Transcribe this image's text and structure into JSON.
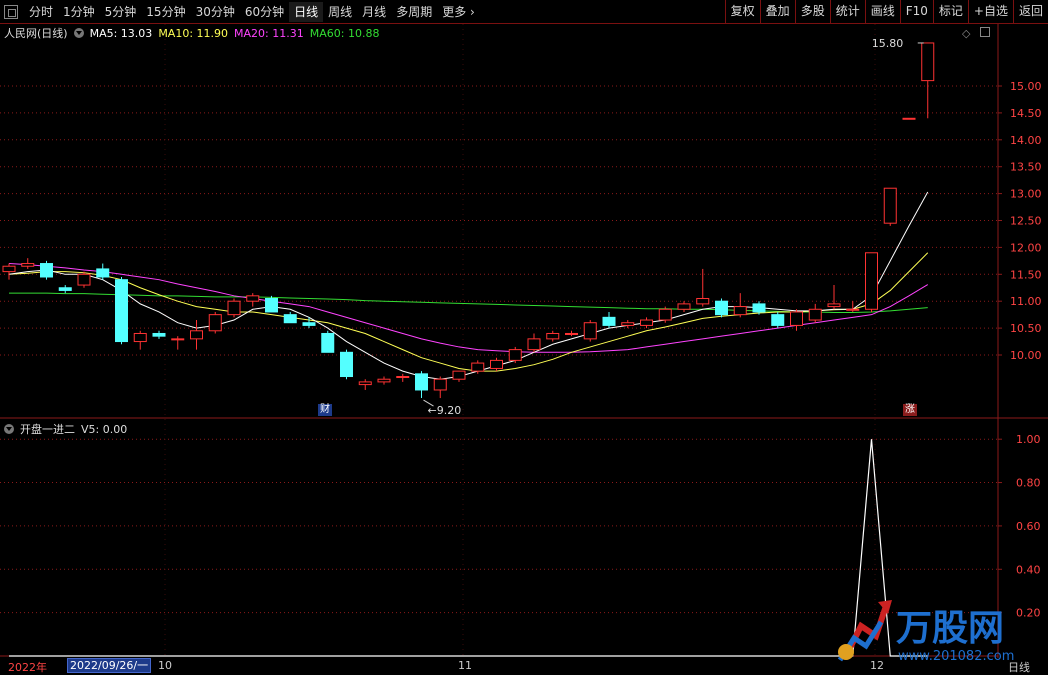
{
  "toolbar": {
    "periods": [
      "分时",
      "1分钟",
      "5分钟",
      "15分钟",
      "30分钟",
      "60分钟",
      "日线",
      "周线",
      "月线",
      "多周期",
      "更多"
    ],
    "active_period": "日线",
    "buttons": [
      "复权",
      "叠加",
      "多股",
      "统计",
      "画线",
      "F10",
      "标记",
      "+自选",
      "返回"
    ]
  },
  "title": {
    "stock": "人民网(日线)",
    "ma5": "MA5: 13.03",
    "ma10": "MA10: 11.90",
    "ma20": "MA20: 11.31",
    "ma60": "MA60: 10.88"
  },
  "indicator": {
    "name": "开盘一进二",
    "value": "V5: 0.00"
  },
  "annotations": {
    "high": "15.80",
    "low": "9.20",
    "cai": "财",
    "zhang": "涨"
  },
  "date_axis": {
    "year": "2022年",
    "date": "2022/09/26/一",
    "m10": "10",
    "m11": "11",
    "m12": "12",
    "period": "日线"
  },
  "watermark": {
    "brand": "万股网",
    "url": "www.201082.com"
  },
  "colors": {
    "up": "#ff3333",
    "down": "#54ffff",
    "ma5": "#ffffff",
    "ma10": "#ffff55",
    "ma20": "#ff44ff",
    "ma60": "#33dd33",
    "grid": "#8b1a1a"
  },
  "chart_data": [
    {
      "type": "candlestick",
      "ylim": [
        9.0,
        16.2
      ],
      "y_ticks": [
        "15.00",
        "14.50",
        "14.00",
        "13.50",
        "13.00",
        "12.50",
        "12.00",
        "11.50",
        "11.00",
        "10.50",
        "10.00"
      ],
      "x_months": [
        "10",
        "11",
        "12"
      ],
      "candles": [
        [
          11.55,
          11.7,
          11.4,
          11.65
        ],
        [
          11.65,
          11.8,
          11.6,
          11.7
        ],
        [
          11.7,
          11.75,
          11.4,
          11.45
        ],
        [
          11.25,
          11.3,
          11.15,
          11.2
        ],
        [
          11.3,
          11.55,
          11.25,
          11.5
        ],
        [
          11.6,
          11.7,
          11.4,
          11.45
        ],
        [
          11.4,
          11.45,
          10.2,
          10.25
        ],
        [
          10.25,
          10.45,
          10.1,
          10.4
        ],
        [
          10.4,
          10.45,
          10.3,
          10.35
        ],
        [
          10.3,
          10.35,
          10.1,
          10.3
        ],
        [
          10.3,
          10.65,
          10.1,
          10.45
        ],
        [
          10.45,
          10.8,
          10.4,
          10.75
        ],
        [
          10.75,
          11.05,
          10.7,
          11.0
        ],
        [
          11.0,
          11.15,
          10.9,
          11.1
        ],
        [
          11.05,
          11.1,
          10.8,
          10.8
        ],
        [
          10.75,
          10.8,
          10.6,
          10.6
        ],
        [
          10.6,
          10.7,
          10.5,
          10.55
        ],
        [
          10.4,
          10.45,
          10.05,
          10.05
        ],
        [
          10.05,
          10.1,
          9.55,
          9.6
        ],
        [
          9.45,
          9.55,
          9.35,
          9.5
        ],
        [
          9.5,
          9.6,
          9.45,
          9.55
        ],
        [
          9.6,
          9.65,
          9.5,
          9.6
        ],
        [
          9.65,
          9.7,
          9.2,
          9.35
        ],
        [
          9.35,
          9.6,
          9.2,
          9.55
        ],
        [
          9.55,
          9.7,
          9.5,
          9.7
        ],
        [
          9.7,
          9.9,
          9.65,
          9.85
        ],
        [
          9.75,
          9.95,
          9.7,
          9.9
        ],
        [
          9.9,
          10.15,
          9.85,
          10.1
        ],
        [
          10.1,
          10.4,
          10.05,
          10.3
        ],
        [
          10.3,
          10.45,
          10.25,
          10.4
        ],
        [
          10.4,
          10.45,
          10.35,
          10.4
        ],
        [
          10.3,
          10.65,
          10.25,
          10.6
        ],
        [
          10.7,
          10.8,
          10.5,
          10.55
        ],
        [
          10.55,
          10.65,
          10.5,
          10.6
        ],
        [
          10.55,
          10.7,
          10.5,
          10.65
        ],
        [
          10.65,
          10.9,
          10.6,
          10.85
        ],
        [
          10.85,
          11.0,
          10.8,
          10.95
        ],
        [
          10.95,
          11.6,
          10.9,
          11.05
        ],
        [
          11.0,
          11.05,
          10.7,
          10.75
        ],
        [
          10.75,
          11.15,
          10.7,
          10.9
        ],
        [
          10.95,
          11.0,
          10.75,
          10.8
        ],
        [
          10.75,
          10.8,
          10.5,
          10.55
        ],
        [
          10.55,
          10.85,
          10.45,
          10.8
        ],
        [
          10.65,
          10.95,
          10.6,
          10.85
        ],
        [
          10.9,
          11.3,
          10.85,
          10.95
        ],
        [
          10.85,
          11.0,
          10.8,
          10.85
        ],
        [
          10.85,
          10.95,
          10.8,
          11.9
        ],
        [
          12.45,
          13.1,
          12.4,
          13.1
        ],
        [
          14.4,
          14.4,
          14.4,
          14.4
        ],
        [
          15.1,
          15.8,
          14.4,
          15.8
        ]
      ],
      "ma5": [
        11.5,
        11.55,
        11.58,
        11.5,
        11.5,
        11.4,
        11.2,
        10.95,
        10.8,
        10.6,
        10.5,
        10.55,
        10.65,
        10.85,
        10.9,
        10.85,
        10.7,
        10.5,
        10.25,
        10.05,
        9.85,
        9.7,
        9.6,
        9.55,
        9.6,
        9.7,
        9.8,
        9.9,
        10.05,
        10.2,
        10.3,
        10.4,
        10.5,
        10.55,
        10.6,
        10.65,
        10.75,
        10.85,
        10.9,
        10.9,
        10.88,
        10.85,
        10.82,
        10.82,
        10.85,
        10.85,
        11.1,
        11.75,
        12.4,
        13.03
      ],
      "ma10": [
        11.5,
        11.52,
        11.55,
        11.55,
        11.53,
        11.48,
        11.4,
        11.25,
        11.12,
        11.0,
        10.9,
        10.85,
        10.8,
        10.8,
        10.75,
        10.7,
        10.65,
        10.6,
        10.5,
        10.4,
        10.25,
        10.1,
        9.95,
        9.85,
        9.75,
        9.7,
        9.7,
        9.75,
        9.82,
        9.92,
        10.05,
        10.15,
        10.25,
        10.35,
        10.45,
        10.52,
        10.6,
        10.68,
        10.72,
        10.75,
        10.78,
        10.8,
        10.8,
        10.82,
        10.84,
        10.85,
        10.95,
        11.2,
        11.55,
        11.9
      ],
      "ma20": [
        11.7,
        11.68,
        11.65,
        11.62,
        11.58,
        11.55,
        11.5,
        11.45,
        11.4,
        11.32,
        11.25,
        11.18,
        11.1,
        11.05,
        11.0,
        10.95,
        10.9,
        10.8,
        10.7,
        10.6,
        10.5,
        10.4,
        10.3,
        10.22,
        10.15,
        10.1,
        10.08,
        10.06,
        10.05,
        10.05,
        10.05,
        10.06,
        10.08,
        10.1,
        10.15,
        10.2,
        10.25,
        10.3,
        10.35,
        10.4,
        10.45,
        10.5,
        10.55,
        10.6,
        10.65,
        10.7,
        10.75,
        10.9,
        11.1,
        11.31
      ],
      "ma60": [
        11.15,
        11.15,
        11.15,
        11.14,
        11.14,
        11.13,
        11.12,
        11.11,
        11.1,
        11.1,
        11.09,
        11.08,
        11.08,
        11.08,
        11.07,
        11.06,
        11.05,
        11.04,
        11.03,
        11.01,
        11.0,
        10.99,
        10.98,
        10.97,
        10.96,
        10.95,
        10.94,
        10.93,
        10.92,
        10.91,
        10.9,
        10.89,
        10.88,
        10.87,
        10.86,
        10.86,
        10.85,
        10.85,
        10.84,
        10.83,
        10.82,
        10.81,
        10.8,
        10.8,
        10.79,
        10.79,
        10.8,
        10.82,
        10.85,
        10.88
      ]
    },
    {
      "type": "line",
      "name": "V5",
      "ylim": [
        0,
        1.1
      ],
      "y_ticks": [
        "1.00",
        "0.80",
        "0.60",
        "0.40",
        "0.20"
      ],
      "values": [
        0,
        0,
        0,
        0,
        0,
        0,
        0,
        0,
        0,
        0,
        0,
        0,
        0,
        0,
        0,
        0,
        0,
        0,
        0,
        0,
        0,
        0,
        0,
        0,
        0,
        0,
        0,
        0,
        0,
        0,
        0,
        0,
        0,
        0,
        0,
        0,
        0,
        0,
        0,
        0,
        0,
        0,
        0,
        0,
        0,
        0,
        1,
        0,
        0,
        0
      ]
    }
  ]
}
